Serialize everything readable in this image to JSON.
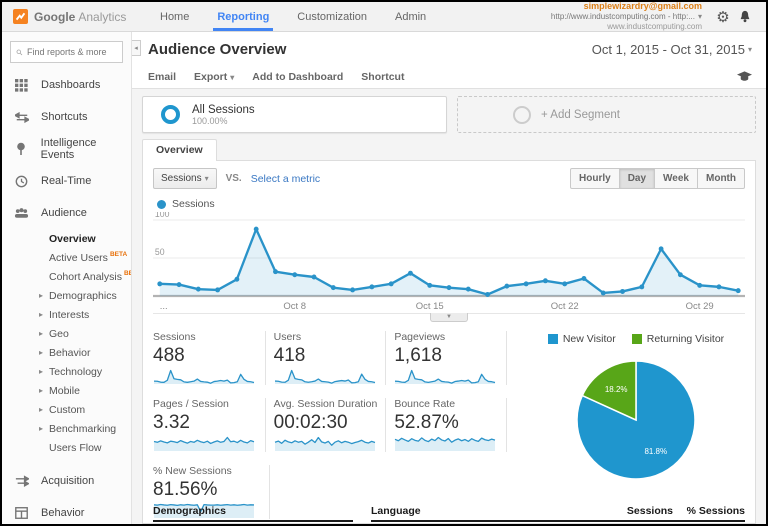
{
  "topbar": {
    "brand": {
      "google": "Google",
      "analytics": "Analytics"
    },
    "nav": [
      {
        "label": "Home"
      },
      {
        "label": "Reporting"
      },
      {
        "label": "Customization"
      },
      {
        "label": "Admin"
      }
    ],
    "active_nav": "Reporting",
    "account": {
      "email": "simplewizardry@gmail.com",
      "property": "http://www.industcomputing.com - http:...",
      "view": "www.industcomputing.com"
    }
  },
  "sidebar": {
    "search_placeholder": "Find reports & more",
    "beta_label": "BETA",
    "items": [
      {
        "label": "Dashboards"
      },
      {
        "label": "Shortcuts"
      },
      {
        "label": "Intelligence Events"
      },
      {
        "label": "Real-Time"
      },
      {
        "label": "Audience"
      }
    ],
    "audience_sub": [
      {
        "label": "Overview"
      },
      {
        "label": "Active Users"
      },
      {
        "label": "Cohort Analysis"
      },
      {
        "label": "Demographics"
      },
      {
        "label": "Interests"
      },
      {
        "label": "Geo"
      },
      {
        "label": "Behavior"
      },
      {
        "label": "Technology"
      },
      {
        "label": "Mobile"
      },
      {
        "label": "Custom"
      },
      {
        "label": "Benchmarking"
      },
      {
        "label": "Users Flow"
      }
    ],
    "bottom_items": [
      {
        "label": "Acquisition"
      },
      {
        "label": "Behavior"
      }
    ]
  },
  "report": {
    "title": "Audience Overview",
    "date_range": "Oct 1, 2015 - Oct 31, 2015",
    "actions": {
      "email": "Email",
      "export": "Export",
      "add_to_dashboard": "Add to Dashboard",
      "shortcut": "Shortcut"
    },
    "segments": {
      "all_sessions": "All Sessions",
      "all_sessions_pct": "100.00%",
      "add_segment": "+ Add Segment"
    },
    "tab": "Overview",
    "controls": {
      "metric": "Sessions",
      "vs": "VS.",
      "select_metric": "Select a metric",
      "granularity": [
        {
          "label": "Hourly"
        },
        {
          "label": "Day"
        },
        {
          "label": "Week"
        },
        {
          "label": "Month"
        }
      ],
      "granularity_active": "Day"
    }
  },
  "scorecards": {
    "rows": [
      [
        {
          "label": "Sessions",
          "value": "488"
        },
        {
          "label": "Users",
          "value": "418"
        },
        {
          "label": "Pageviews",
          "value": "1,618"
        }
      ],
      [
        {
          "label": "Pages / Session",
          "value": "3.32"
        },
        {
          "label": "Avg. Session Duration",
          "value": "00:02:30"
        },
        {
          "label": "Bounce Rate",
          "value": "52.87%"
        }
      ],
      [
        {
          "label": "% New Sessions",
          "value": "81.56%"
        }
      ]
    ],
    "sparks": {
      "sessions": [
        16,
        15,
        9,
        8,
        22,
        88,
        32,
        28,
        25,
        11,
        8,
        12,
        16,
        30,
        14,
        11,
        9,
        2,
        13,
        16,
        20,
        16,
        23,
        4,
        6,
        12,
        62,
        28,
        14,
        12,
        7
      ],
      "users": [
        14,
        13,
        8,
        7,
        19,
        75,
        28,
        24,
        21,
        10,
        7,
        10,
        14,
        26,
        12,
        10,
        8,
        2,
        11,
        14,
        17,
        14,
        20,
        4,
        5,
        10,
        54,
        24,
        12,
        10,
        6
      ],
      "pageviews": [
        52,
        48,
        30,
        26,
        72,
        290,
        105,
        92,
        82,
        36,
        26,
        40,
        54,
        98,
        46,
        36,
        30,
        8,
        44,
        54,
        66,
        54,
        76,
        14,
        20,
        40,
        205,
        95,
        46,
        40,
        22
      ],
      "pages_per_session": [
        3.2,
        2.9,
        3.4,
        3.0,
        2.7,
        3.3,
        3.1,
        2.8,
        3.5,
        3.0,
        2.6,
        3.2,
        2.9,
        3.6,
        3.1,
        2.8,
        3.3,
        2.5,
        3.0,
        3.4,
        2.9,
        3.2,
        4.6,
        3.1,
        3.3,
        2.8,
        3.6,
        3.0,
        2.7,
        3.5,
        3.1
      ],
      "avg_session_duration": [
        150,
        170,
        130,
        185,
        155,
        140,
        175,
        150,
        165,
        115,
        150,
        195,
        145,
        235,
        155,
        135,
        165,
        95,
        150,
        175,
        140,
        165,
        150,
        125,
        145,
        160,
        185,
        150,
        135,
        165,
        145
      ],
      "bounce_rate": [
        55,
        48,
        60,
        52,
        45,
        58,
        50,
        46,
        62,
        50,
        44,
        56,
        49,
        64,
        52,
        47,
        59,
        41,
        51,
        57,
        48,
        54,
        45,
        58,
        50,
        45,
        61,
        53,
        49,
        56,
        51
      ],
      "pct_new_sessions": [
        86,
        84,
        88,
        85,
        83,
        87,
        85,
        82,
        86,
        84,
        88,
        85,
        83,
        86,
        40,
        87,
        85,
        84,
        84,
        86,
        83,
        85,
        87,
        84,
        86,
        83,
        85,
        88,
        84,
        86,
        85
      ]
    }
  },
  "table": {
    "headers": {
      "demographics": "Demographics",
      "language": "Language",
      "sessions": "Sessions",
      "pct_sessions": "% Sessions"
    }
  },
  "chart_data": [
    {
      "id": "sessions-over-time",
      "type": "line",
      "title": "Sessions",
      "x_unit": "day (Oct 1 - Oct 31, 2015)",
      "x_ticks": [
        {
          "index": 0,
          "label": "..."
        },
        {
          "index": 7,
          "label": "Oct 8"
        },
        {
          "index": 14,
          "label": "Oct 15"
        },
        {
          "index": 21,
          "label": "Oct 22"
        },
        {
          "index": 28,
          "label": "Oct 29"
        }
      ],
      "ylim": [
        0,
        100
      ],
      "yticks": [
        50,
        100
      ],
      "grid": true,
      "legend_position": "top-left",
      "color": "#2a93c9",
      "series": [
        {
          "name": "Sessions",
          "values": [
            16,
            15,
            9,
            8,
            22,
            88,
            32,
            28,
            25,
            11,
            8,
            12,
            16,
            30,
            14,
            11,
            9,
            2,
            13,
            16,
            20,
            16,
            23,
            4,
            6,
            12,
            62,
            28,
            14,
            12,
            7
          ]
        }
      ]
    },
    {
      "id": "new-vs-returning-visitors",
      "type": "pie",
      "labels": [
        "New Visitor",
        "Returning Visitor"
      ],
      "values": [
        81.8,
        18.2
      ],
      "slice_labels": [
        "81.8%",
        "18.2%"
      ],
      "colors": [
        "#1f96ce",
        "#58a618"
      ],
      "legend_position": "top"
    }
  ]
}
